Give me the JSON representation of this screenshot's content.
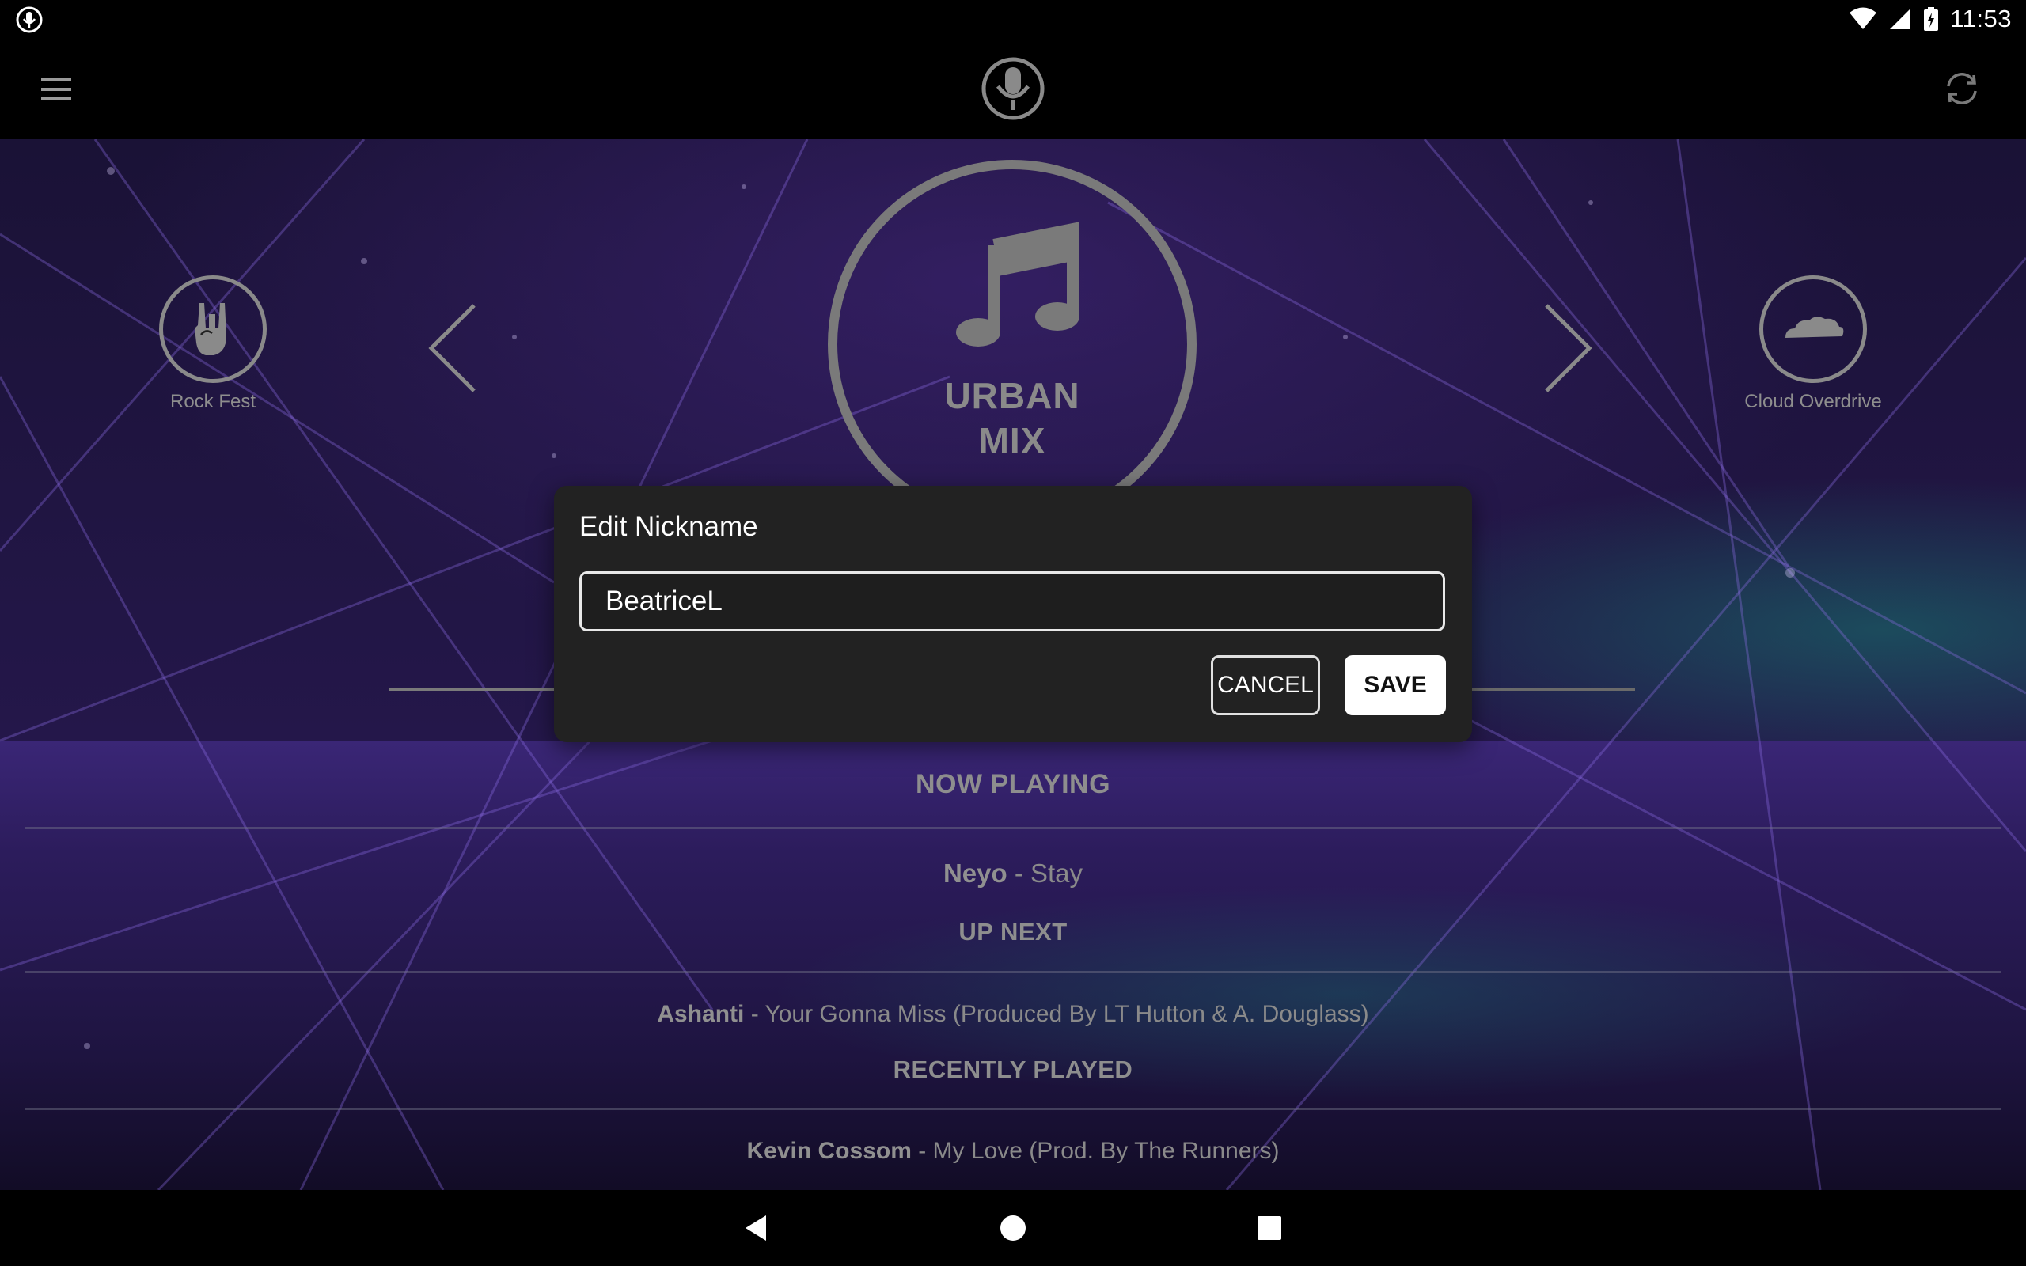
{
  "status_bar": {
    "time": "11:53",
    "icons": [
      "mic-status-icon",
      "wifi-icon",
      "signal-icon",
      "battery-icon"
    ]
  },
  "app_bar": {
    "menu_icon": "hamburger-menu-icon",
    "logo_icon": "microphone-logo-icon",
    "refresh_icon": "refresh-icon"
  },
  "stations": {
    "left": {
      "label": "Rock Fest",
      "icon": "rock-hand-icon"
    },
    "current": {
      "title_line1": "URBAN",
      "title_line2": "MIX",
      "icon": "music-note-icon"
    },
    "right": {
      "label": "Cloud Overdrive",
      "icon": "cloud-icon"
    }
  },
  "now_playing": {
    "heading": "NOW PLAYING",
    "artist": "Neyo",
    "separator": " - ",
    "title": "Stay"
  },
  "up_next": {
    "heading": "UP NEXT",
    "artist": "Ashanti",
    "separator": " - ",
    "title": "Your Gonna Miss (Produced By LT Hutton & A. Douglass)"
  },
  "recently_played": {
    "heading": "RECENTLY PLAYED",
    "artist": "Kevin Cossom",
    "separator": " - ",
    "title": "My Love (Prod. By The Runners)"
  },
  "dialog": {
    "title": "Edit Nickname",
    "input_value": "BeatriceL",
    "cancel_label": "CANCEL",
    "save_label": "SAVE"
  },
  "colors": {
    "accent_purple": "#2c1c5c",
    "dialog_bg": "#222222",
    "muted_gray": "#8a8a8a"
  }
}
